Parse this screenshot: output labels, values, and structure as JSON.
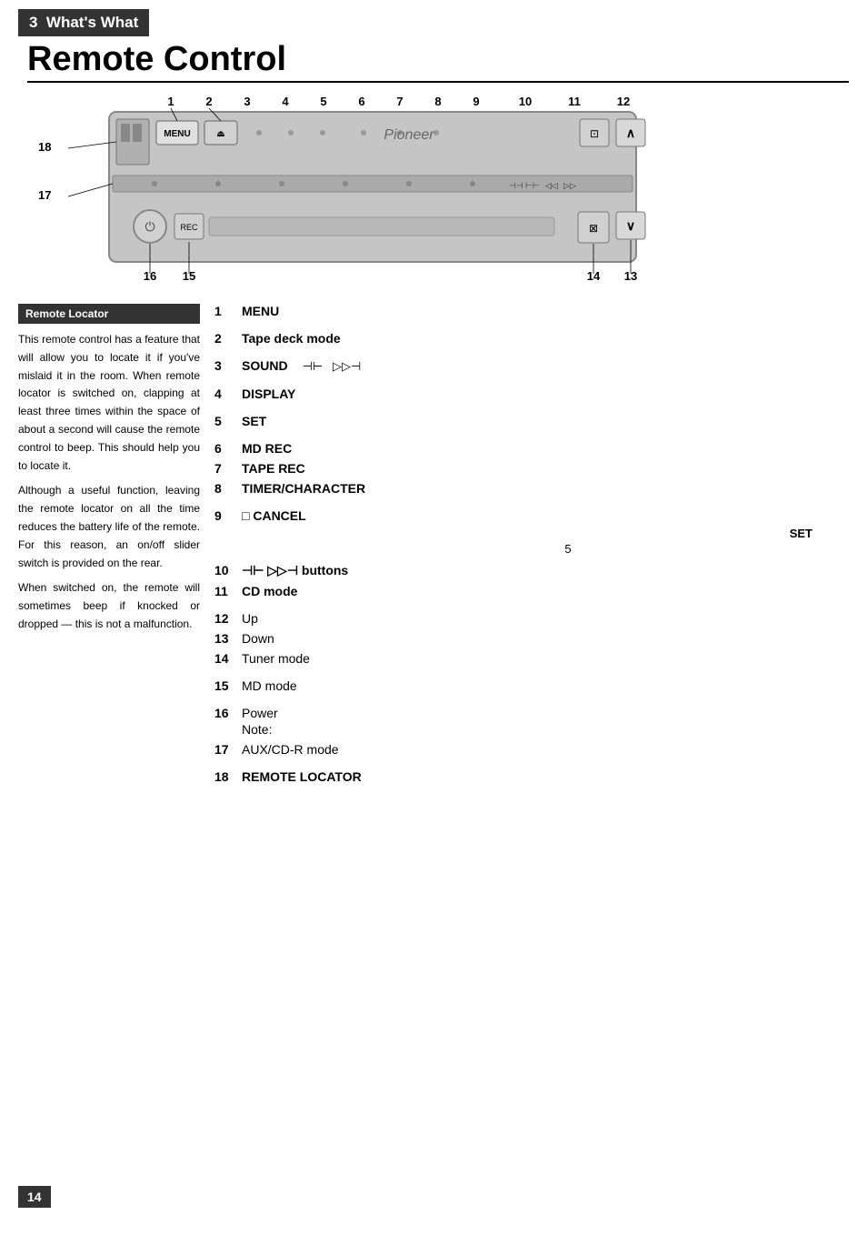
{
  "chapter": {
    "number": "3",
    "title": "What's What"
  },
  "page_title": "Remote Control",
  "diagram": {
    "top_numbers": [
      "1",
      "2",
      "3",
      "4",
      "5",
      "6",
      "7",
      "8",
      "9",
      "10",
      "11",
      "12"
    ],
    "side_labels_left": [
      "18",
      "17"
    ],
    "bottom_numbers_left": [
      "16",
      "15"
    ],
    "bottom_numbers_right": [
      "14",
      "13"
    ],
    "brand": "Pioneer"
  },
  "remote_locator": {
    "header": "Remote Locator",
    "paragraphs": [
      "This remote control has a feature that will allow you to locate it if you've mislaid it in the room. When remote locator is switched on, clapping at least three times within the space of about a second will cause the remote control to beep. This should help you to locate it.",
      "Although a useful function, leaving the remote locator on all the time reduces the battery life of the remote. For this reason, an on/off slider switch is provided on the rear.",
      "When switched on, the remote will sometimes beep if knocked or dropped — this is not a malfunction."
    ]
  },
  "items": [
    {
      "num": "1",
      "label": "MENU",
      "extra": ""
    },
    {
      "num": "2",
      "label": "Tape deck mode",
      "extra": ""
    },
    {
      "num": "3",
      "label": "SOUND",
      "extra": "⊣⊢  ▷▷⊣",
      "symbols": true
    },
    {
      "num": "4",
      "label": "DISPLAY",
      "extra": ""
    },
    {
      "num": "5",
      "label": "SET",
      "extra": ""
    },
    {
      "num": "6",
      "label": "MD REC",
      "extra": ""
    },
    {
      "num": "7",
      "label": "TAPE REC",
      "extra": ""
    },
    {
      "num": "8",
      "label": "TIMER/CHARACTER",
      "extra": ""
    },
    {
      "num": "9",
      "label": "□ CANCEL",
      "extra": ""
    },
    {
      "num": "10",
      "label": "⊣⊢ ▷▷⊣ buttons",
      "extra": ""
    },
    {
      "num": "11",
      "label": "CD mode",
      "extra": ""
    },
    {
      "num": "12",
      "label": "Up",
      "extra": ""
    },
    {
      "num": "13",
      "label": "Down",
      "extra": ""
    },
    {
      "num": "14",
      "label": "Tuner mode",
      "extra": ""
    },
    {
      "num": "15",
      "label": "MD mode",
      "extra": ""
    },
    {
      "num": "16",
      "label": "Power",
      "note": "Note:"
    },
    {
      "num": "17",
      "label": "AUX/CD-R mode",
      "extra": ""
    },
    {
      "num": "18",
      "label": "REMOTE LOCATOR",
      "extra": ""
    }
  ],
  "set_note": "SET",
  "sub_note_5": "5",
  "page_number": "14"
}
